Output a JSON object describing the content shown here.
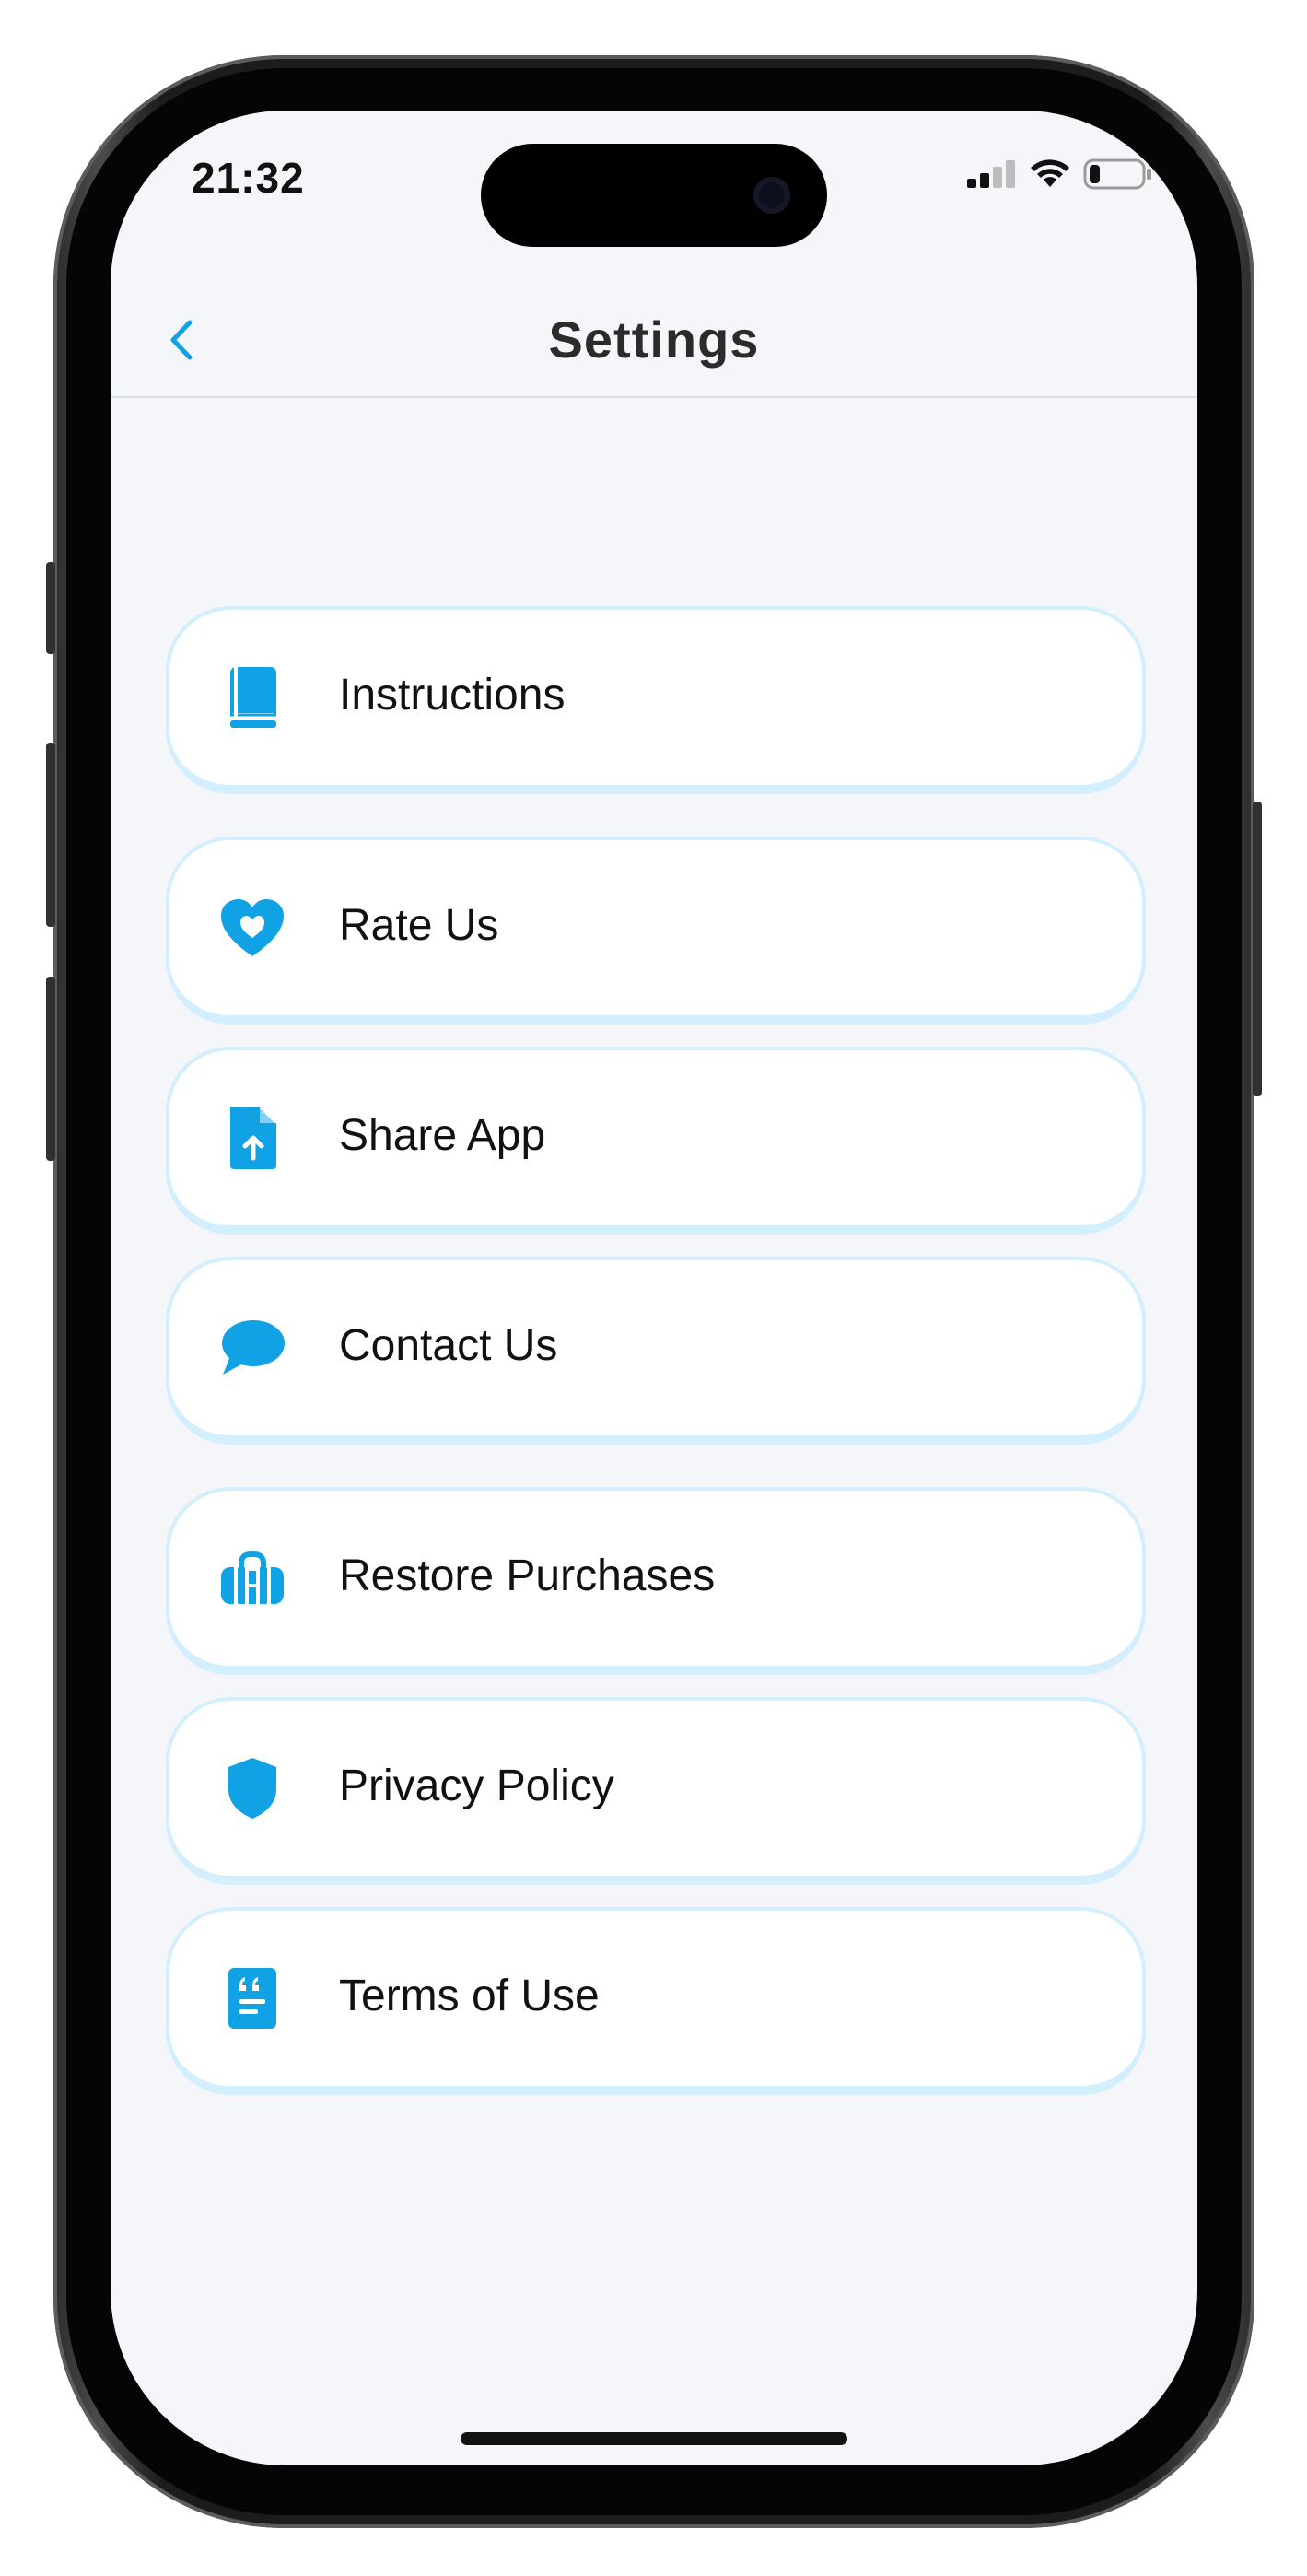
{
  "status_bar": {
    "time": "21:32",
    "battery_level": 0.2
  },
  "nav": {
    "title": "Settings",
    "back_icon": "chevron-left-icon"
  },
  "colors": {
    "accent": "#10a2e4",
    "card_border": "#d3eefc",
    "background": "#f4f6fa"
  },
  "menu": {
    "items": [
      {
        "label": "Instructions",
        "icon": "book-icon"
      },
      {
        "label": "Rate Us",
        "icon": "heart-icon"
      },
      {
        "label": "Share App",
        "icon": "file-upload-icon"
      },
      {
        "label": "Contact Us",
        "icon": "chat-bubble-icon"
      },
      {
        "label": "Restore Purchases",
        "icon": "bag-icon"
      },
      {
        "label": "Privacy Policy",
        "icon": "shield-icon"
      },
      {
        "label": "Terms of Use",
        "icon": "quote-document-icon"
      }
    ]
  }
}
